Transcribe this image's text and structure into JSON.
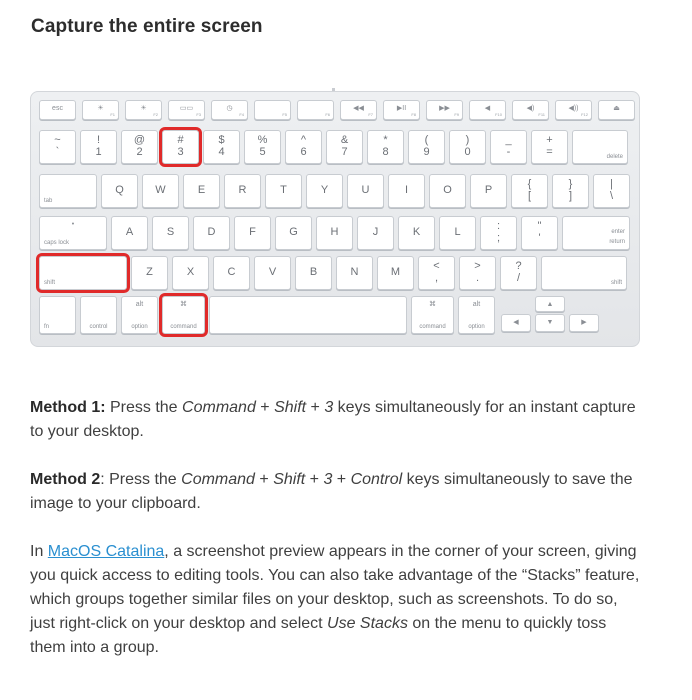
{
  "title": "Capture the entire screen",
  "keyboard": {
    "fn_row": [
      {
        "label": "esc",
        "fn": ""
      },
      {
        "label": "☀",
        "fn": "F1"
      },
      {
        "label": "☀",
        "fn": "F2"
      },
      {
        "label": "▭▭",
        "fn": "F3"
      },
      {
        "label": "◷",
        "fn": "F4"
      },
      {
        "label": "",
        "fn": "F5"
      },
      {
        "label": "",
        "fn": "F6"
      },
      {
        "label": "◀◀",
        "fn": "F7"
      },
      {
        "label": "▶II",
        "fn": "F8"
      },
      {
        "label": "▶▶",
        "fn": "F9"
      },
      {
        "label": "◀",
        "fn": "F10"
      },
      {
        "label": "◀)",
        "fn": "F11"
      },
      {
        "label": "◀))",
        "fn": "F12"
      },
      {
        "label": "⏏",
        "fn": ""
      }
    ],
    "num_row": [
      {
        "top": "~",
        "bot": "`"
      },
      {
        "top": "!",
        "bot": "1"
      },
      {
        "top": "@",
        "bot": "2"
      },
      {
        "top": "#",
        "bot": "3"
      },
      {
        "top": "$",
        "bot": "4"
      },
      {
        "top": "%",
        "bot": "5"
      },
      {
        "top": "^",
        "bot": "6"
      },
      {
        "top": "&",
        "bot": "7"
      },
      {
        "top": "*",
        "bot": "8"
      },
      {
        "top": "(",
        "bot": "9"
      },
      {
        "top": ")",
        "bot": "0"
      },
      {
        "top": "_",
        "bot": "-"
      },
      {
        "top": "+",
        "bot": "="
      },
      {
        "top": "",
        "bot": "delete"
      }
    ],
    "tab_row": [
      {
        "top": "",
        "bot": "tab"
      },
      {
        "top": "",
        "bot": "Q"
      },
      {
        "top": "",
        "bot": "W"
      },
      {
        "top": "",
        "bot": "E"
      },
      {
        "top": "",
        "bot": "R"
      },
      {
        "top": "",
        "bot": "T"
      },
      {
        "top": "",
        "bot": "Y"
      },
      {
        "top": "",
        "bot": "U"
      },
      {
        "top": "",
        "bot": "I"
      },
      {
        "top": "",
        "bot": "O"
      },
      {
        "top": "",
        "bot": "P"
      },
      {
        "top": "{",
        "bot": "["
      },
      {
        "top": "}",
        "bot": "]"
      },
      {
        "top": "|",
        "bot": "\\"
      }
    ],
    "caps_row": [
      {
        "top": "•",
        "bot": "caps lock"
      },
      {
        "top": "",
        "bot": "A"
      },
      {
        "top": "",
        "bot": "S"
      },
      {
        "top": "",
        "bot": "D"
      },
      {
        "top": "",
        "bot": "F"
      },
      {
        "top": "",
        "bot": "G"
      },
      {
        "top": "",
        "bot": "H"
      },
      {
        "top": "",
        "bot": "J"
      },
      {
        "top": "",
        "bot": "K"
      },
      {
        "top": "",
        "bot": "L"
      },
      {
        "top": ":",
        "bot": ";"
      },
      {
        "top": "\"",
        "bot": "'"
      },
      {
        "top": "enter",
        "bot": "return"
      }
    ],
    "shift_row": [
      {
        "top": "",
        "bot": "shift"
      },
      {
        "top": "",
        "bot": "Z"
      },
      {
        "top": "",
        "bot": "X"
      },
      {
        "top": "",
        "bot": "C"
      },
      {
        "top": "",
        "bot": "V"
      },
      {
        "top": "",
        "bot": "B"
      },
      {
        "top": "",
        "bot": "N"
      },
      {
        "top": "",
        "bot": "M"
      },
      {
        "top": "<",
        "bot": ","
      },
      {
        "top": ">",
        "bot": "."
      },
      {
        "top": "?",
        "bot": "/"
      },
      {
        "top": "",
        "bot": "shift"
      }
    ],
    "bottom_row": [
      {
        "top": "",
        "bot": "fn"
      },
      {
        "top": "",
        "bot": "control"
      },
      {
        "top": "alt",
        "bot": "option"
      },
      {
        "top": "⌘",
        "bot": "command"
      },
      {
        "top": "",
        "bot": ""
      },
      {
        "top": "⌘",
        "bot": "command"
      },
      {
        "top": "alt",
        "bot": "option"
      }
    ],
    "arrows": {
      "up": "▲",
      "left": "◀",
      "down": "▼",
      "right": "▶"
    },
    "highlight_color": "#e02a2a"
  },
  "method1": {
    "label": "Method 1:",
    "t1": " Press the ",
    "cmd": "Command",
    "plus1": " + ",
    "shift": "Shift",
    "plus2": " + ",
    "three": "3",
    "t2": " keys simultaneously for an instant capture to your desktop."
  },
  "method2": {
    "label": "Method 2",
    "t1": ": Press the ",
    "cmd": "Command",
    "plus1": " + ",
    "shift": "Shift",
    "plus2": " + ",
    "three": "3",
    "plus3": " + ",
    "control": "Control",
    "t2": " keys simultaneously to save the image to your clipboard."
  },
  "para3": {
    "t1": "In ",
    "link": "MacOS Catalina",
    "t2": ", a screenshot preview appears in the corner of your screen, giving you quick access to editing tools. You can also take advantage of the “Stacks” feature, which groups together similar files on your desktop, such as screenshots. To do so, just right-click on your desktop and select ",
    "use_stacks": "Use Stacks",
    "t3": " on the menu to quickly toss them into a group."
  }
}
